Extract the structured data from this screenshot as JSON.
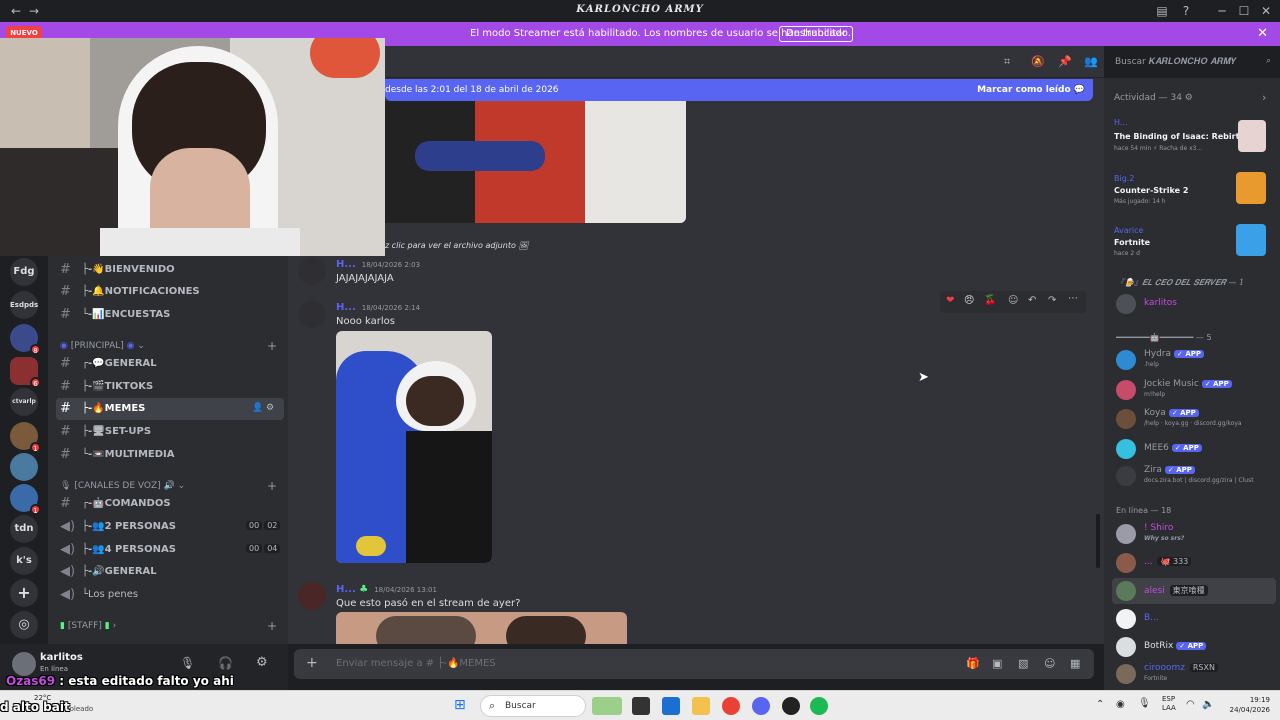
{
  "window": {
    "title": "𝑲𝑨𝑹𝑳𝑶𝑵𝑪𝑯𝑶 𝑨𝑹𝑴𝒀"
  },
  "banner": {
    "text": "El modo Streamer está habilitado. Los nombres de usuario se han truncado.",
    "button": "Deshabilitar",
    "new_badge": "NUEVO"
  },
  "header": {
    "search_placeholder": "Buscar 𝑲𝑨𝑹𝑳𝑶𝑵𝑪𝑯𝑶 𝑨𝑹𝑴𝒀"
  },
  "new_messages": {
    "text": "desde las 2:01 del 18 de abril de 2026",
    "mark_read": "Marcar como leído"
  },
  "servers": [
    {
      "label": "Fdg"
    },
    {
      "label": "Esdpds"
    },
    {
      "label": "",
      "badge": "8"
    },
    {
      "label": "",
      "badge": "6"
    },
    {
      "label": "ctvarlp"
    },
    {
      "label": "",
      "badge": "1"
    },
    {
      "label": ""
    },
    {
      "label": "",
      "badge": "1"
    },
    {
      "label": "tdn"
    },
    {
      "label": "k's"
    }
  ],
  "channels": [
    {
      "name": "├-👋BIENVENIDO",
      "type": "text"
    },
    {
      "name": "├-🔔NOTIFICACIONES",
      "type": "text"
    },
    {
      "name": "└-📊ENCUESTAS",
      "type": "text"
    },
    {
      "category": "[PRINCIPAL]"
    },
    {
      "name": "┌-💬GENERAL",
      "type": "text"
    },
    {
      "name": "├-🎬TIKTOKS",
      "type": "text"
    },
    {
      "name": "├-🔥MEMES",
      "type": "text",
      "active": true
    },
    {
      "name": "├-🖥SET-UPS",
      "type": "text"
    },
    {
      "name": "└-📼MULTIMEDIA",
      "type": "text"
    },
    {
      "category": "[CANALES DE VOZ]"
    },
    {
      "name": "┌-🤖COMANDOS",
      "type": "text"
    },
    {
      "name": "├-👥2 PERSONAS",
      "type": "voice",
      "c1": "00",
      "c2": "02"
    },
    {
      "name": "├-👥4 PERSONAS",
      "type": "voice",
      "c1": "00",
      "c2": "04"
    },
    {
      "name": "├-🔊GENERAL",
      "type": "voice"
    },
    {
      "name": "└Los penes",
      "type": "voice"
    },
    {
      "category": "[STAFF]"
    }
  ],
  "user": {
    "name": "karlitos",
    "status": "En línea"
  },
  "messages": [
    {
      "caption": "z clic para ver el archivo adjunto"
    },
    {
      "user": "H...",
      "time": "18/04/2026 2:03",
      "text": "JAJAJAJAJAJA"
    },
    {
      "user": "H...",
      "time": "18/04/2026 2:14",
      "text": "Nooo karlos"
    },
    {
      "user": "H...",
      "time": "18/04/2026 13:01",
      "text": "Que esto pasó en el stream de ayer?"
    }
  ],
  "composer": {
    "placeholder": "Enviar mensaje a # ├-🔥MEMES"
  },
  "activity": {
    "title": "Actividad — 34",
    "items": [
      {
        "user": "H...",
        "game": "The Binding of Isaac: Rebirth",
        "meta": "hace 54 min  ⚡ Racha de x3..."
      },
      {
        "user": "Big.2",
        "game": "Counter-Strike 2",
        "meta": "Más jugado: 14 h"
      },
      {
        "user": "Avarice",
        "game": "Fortnite",
        "meta": "hace 2 d"
      }
    ]
  },
  "member_sections": [
    {
      "title": "『🍺』𝑬𝑳 𝑪𝑬𝑶 𝑫𝑬𝑳 𝑺𝑬𝑹𝑽𝑬𝑹 — 1"
    },
    {
      "title": "━━━━━━━🤖━━━━━━━ — 5"
    },
    {
      "title": "En línea — 18"
    }
  ],
  "members": [
    {
      "name": "karlitos",
      "sub": ""
    },
    {
      "name": "Hydra",
      "app": "✓ APP",
      "sub": ".help"
    },
    {
      "name": "Jockie Music",
      "app": "✓ APP",
      "sub": "m!help"
    },
    {
      "name": "Koya",
      "app": "✓ APP",
      "sub": "/help · koya.gg · discord.gg/koya"
    },
    {
      "name": "MEE6",
      "app": "✓ APP",
      "sub": ""
    },
    {
      "name": "Zira",
      "app": "✓ APP",
      "sub": "docs.zira.bot | discord.gg/zira | Clust"
    },
    {
      "name": "! Shiro",
      "sub": "Why so srs?"
    },
    {
      "name": "...",
      "tag": "🐙 333",
      "sub": ""
    },
    {
      "name": "alesi",
      "tag": "東京喰種",
      "sub": ""
    },
    {
      "name": "B...",
      "sub": ""
    },
    {
      "name": "BotRix",
      "app": "✓ APP",
      "sub": ""
    },
    {
      "name": "cirooomz",
      "tag": "RSXN",
      "sub": "Fortnite"
    }
  ],
  "overlay": {
    "nick": "Ozas69",
    "text": " : esta editado falto yo ahi",
    "line2": "d alto bait"
  },
  "taskbar": {
    "weather_temp": "22°C",
    "weather_text": "soleado",
    "search": "Buscar",
    "lang": "ESP",
    "lang2": "LAA",
    "time": "19:19",
    "date": "24/04/2026"
  },
  "colors": {
    "accent": "#5865f2",
    "banner": "#a349e6"
  }
}
